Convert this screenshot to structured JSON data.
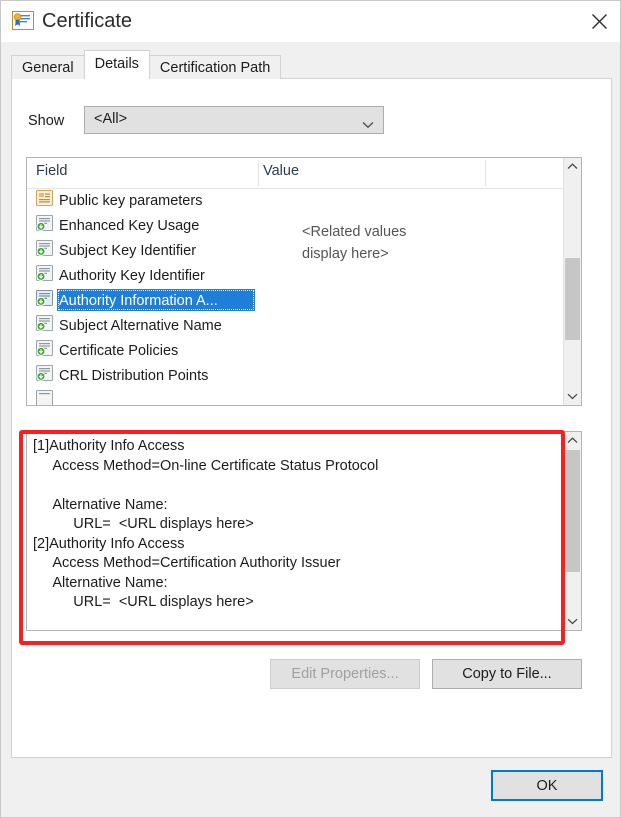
{
  "window": {
    "title": "Certificate",
    "icon": "certificate-icon",
    "close_label": "✕"
  },
  "tabs": [
    {
      "label": "General",
      "active": false
    },
    {
      "label": "Details",
      "active": true
    },
    {
      "label": "Certification Path",
      "active": false
    }
  ],
  "show": {
    "label": "Show",
    "value": "<All>",
    "options": [
      "<All>"
    ]
  },
  "field_list": {
    "columns": [
      "Field",
      "Value"
    ],
    "value_note": "<Related values\ndisplay here>",
    "rows": [
      {
        "label": "Public key parameters",
        "icon": "certificate-field-icon",
        "icon_variant": "orange",
        "selected": false
      },
      {
        "label": "Enhanced Key Usage",
        "icon": "certificate-extension-icon",
        "icon_variant": "gray",
        "selected": false
      },
      {
        "label": "Subject Key Identifier",
        "icon": "certificate-extension-icon",
        "icon_variant": "gray",
        "selected": false
      },
      {
        "label": "Authority Key Identifier",
        "icon": "certificate-extension-icon",
        "icon_variant": "gray",
        "selected": false
      },
      {
        "label": "Authority Information A...",
        "icon": "certificate-extension-icon",
        "icon_variant": "gray",
        "selected": true
      },
      {
        "label": "Subject Alternative Name",
        "icon": "certificate-extension-icon",
        "icon_variant": "gray",
        "selected": false
      },
      {
        "label": "Certificate Policies",
        "icon": "certificate-extension-icon",
        "icon_variant": "gray",
        "selected": false
      },
      {
        "label": "CRL Distribution Points",
        "icon": "certificate-extension-icon",
        "icon_variant": "gray",
        "selected": false
      },
      {
        "label": "",
        "icon": "certificate-extension-icon",
        "icon_variant": "gray",
        "selected": false
      }
    ]
  },
  "detail": {
    "text": "[1]Authority Info Access\n     Access Method=On-line Certificate Status Protocol\n\n     Alternative Name:\n          URL=  <URL displays here>\n[2]Authority Info Access\n     Access Method=Certification Authority Issuer\n     Alternative Name:\n          URL=  <URL displays here>"
  },
  "annotation": {
    "shape": "rectangle",
    "color": "#fb1f1f"
  },
  "buttons": {
    "edit_properties": {
      "label": "Edit Properties...",
      "enabled": false
    },
    "copy_to_file": {
      "label": "Copy to File...",
      "enabled": true
    },
    "ok": {
      "label": "OK",
      "default": true
    }
  },
  "colors": {
    "selection": "#1f7ed8",
    "accent": "#0078d7",
    "annotation": "#fb1f1f",
    "dialog_bg": "#f0f0f0",
    "panel_bg": "#ffffff"
  }
}
